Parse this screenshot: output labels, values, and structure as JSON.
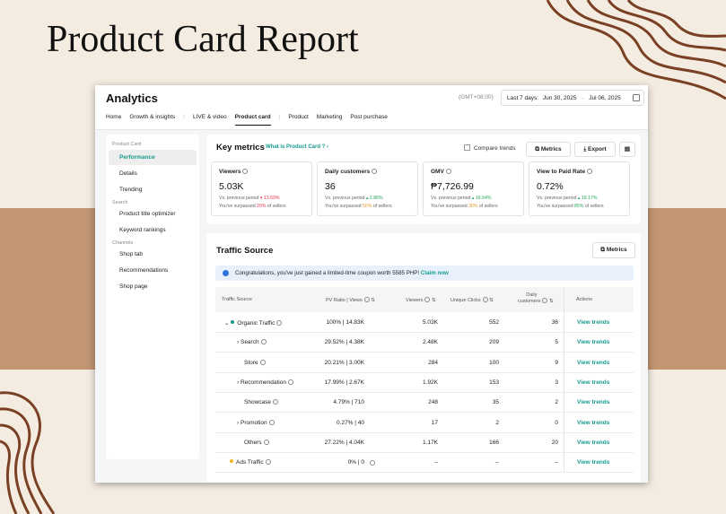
{
  "slide": {
    "title": "Product Card Report"
  },
  "app": {
    "title": "Analytics",
    "timezone": "(GMT+08:00)",
    "range_label": "Last 7 days:",
    "range_start": "Jun 30, 2025",
    "range_sep": "-",
    "range_end": "Jul 06, 2025"
  },
  "tabs": [
    "Home",
    "Growth & insights",
    "LIVE & video",
    "Product card",
    "Product",
    "Marketing",
    "Post purchase"
  ],
  "sidebar": {
    "section1": "Product Card",
    "items1": [
      "Performance",
      "Details",
      "Trending"
    ],
    "section2": "Search",
    "items2": [
      "Product title optimizer",
      "Keyword rankings"
    ],
    "section3": "Channels",
    "items3": [
      "Shop tab",
      "Recommendations",
      "Shop page"
    ]
  },
  "key_metrics": {
    "title": "Key metrics",
    "link": "What is Product Card ?  ›",
    "compare_label": "Compare trends",
    "metrics_btn": "Metrics",
    "export_btn": "Export",
    "cards": [
      {
        "title": "Viewers",
        "value": "5.03K",
        "prev_label": "Vs. previous period",
        "change": "▾ 13.69%",
        "surpass_pre": "You've surpassed ",
        "surpass_pct": "20%",
        "surpass_post": " of sellers"
      },
      {
        "title": "Daily customers",
        "value": "36",
        "prev_label": "Vs. previous period",
        "change": "▴ 2.86%",
        "surpass_pre": "You've surpassed ",
        "surpass_pct": "50%",
        "surpass_post": " of sellers"
      },
      {
        "title": "GMV",
        "value": "₱7,726.99",
        "prev_label": "Vs. previous period",
        "change": "▴ 16.54%",
        "surpass_pre": "You've surpassed ",
        "surpass_pct": "30%",
        "surpass_post": " of sellers"
      },
      {
        "title": "View to Paid Rate",
        "value": "0.72%",
        "prev_label": "Vs. previous period",
        "change": "▴ 19.17%",
        "surpass_pre": "You've surpassed ",
        "surpass_pct": "85%",
        "surpass_post": " of sellers"
      }
    ]
  },
  "traffic": {
    "title": "Traffic Source",
    "metrics_btn": "Metrics",
    "banner_text": "Congratulations, you've just gained a limited-time coupon worth 5585 PHP!",
    "banner_link": "Claim now",
    "headers": {
      "source": "Traffic Source",
      "pv": "PV Ratio | Views",
      "viewers": "Viewers",
      "clicks": "Unique Clicks",
      "daily1": "Daily",
      "daily2": "customers",
      "actions": "Actions"
    },
    "rows": [
      {
        "prefix": "⌄",
        "name": "Organic Traffic",
        "pv": "100% | 14.83K",
        "viewers": "5.03K",
        "clicks": "552",
        "daily": "36",
        "action": "View trends"
      },
      {
        "prefix": "›",
        "name": "Search",
        "pv": "29.52% | 4.38K",
        "viewers": "2.48K",
        "clicks": "209",
        "daily": "5",
        "action": "View trends"
      },
      {
        "prefix": "",
        "name": "Store",
        "pv": "20.21% | 3.00K",
        "viewers": "284",
        "clicks": "100",
        "daily": "9",
        "action": "View trends"
      },
      {
        "prefix": "›",
        "name": "Recommendation",
        "pv": "17.99% | 2.67K",
        "viewers": "1.92K",
        "clicks": "153",
        "daily": "3",
        "action": "View trends"
      },
      {
        "prefix": "",
        "name": "Showcase",
        "pv": "4.79% | 710",
        "viewers": "248",
        "clicks": "35",
        "daily": "2",
        "action": "View trends"
      },
      {
        "prefix": "›",
        "name": "Promotion",
        "pv": "0.27% | 40",
        "viewers": "17",
        "clicks": "2",
        "daily": "0",
        "action": "View trends"
      },
      {
        "prefix": "",
        "name": "Others",
        "pv": "27.22% | 4.04K",
        "viewers": "1.17K",
        "clicks": "166",
        "daily": "20",
        "action": "View trends"
      },
      {
        "prefix": "",
        "name": "Ads Traffic",
        "pv": "0% | 0",
        "viewers": "--",
        "clicks": "--",
        "daily": "--",
        "action": "View trends"
      }
    ]
  },
  "colors": {
    "accent": "#169b8d",
    "band": "#c29672",
    "swirl": "#7a4024",
    "background": "#f4ece1"
  }
}
